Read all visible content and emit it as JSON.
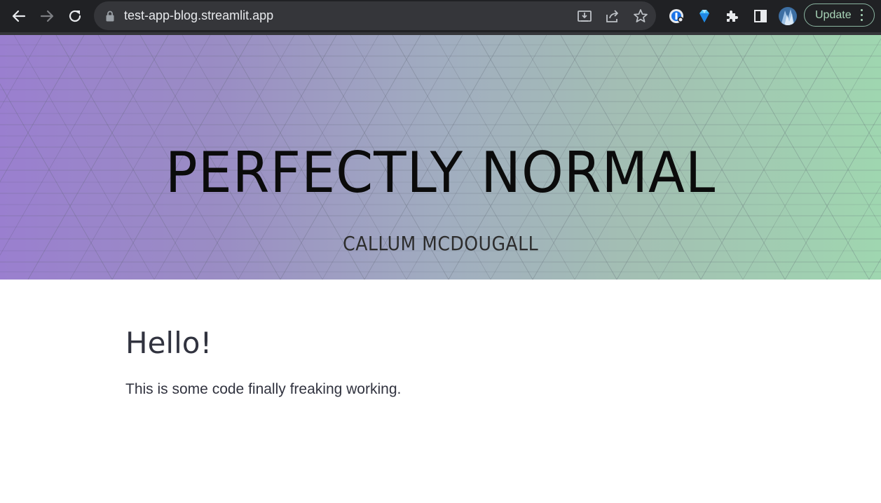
{
  "browser": {
    "url": "test-app-blog.streamlit.app",
    "update_label": "Update",
    "toolbar_icons": [
      "back-arrow-icon",
      "forward-arrow-icon",
      "reload-icon",
      "lock-icon",
      "install-app-icon",
      "share-icon",
      "bookmark-star-icon",
      "onepassword-extension-icon",
      "gem-extension-icon",
      "puzzle-extensions-icon",
      "side-panel-icon",
      "profile-avatar",
      "more-menu-icon"
    ]
  },
  "banner": {
    "title": "PERFECTLY NORMAL",
    "subtitle": "CALLUM MCDOUGALL",
    "gradient_colors": [
      "#9a7fcf",
      "#a1adc0",
      "#9fd6b0"
    ]
  },
  "main": {
    "heading": "Hello!",
    "body": "This is some code finally freaking working."
  },
  "colors": {
    "chrome_bg": "#202124",
    "omnibox_bg": "#35363a",
    "text_dark": "#31333f",
    "update_accent": "#a8d5b8"
  }
}
